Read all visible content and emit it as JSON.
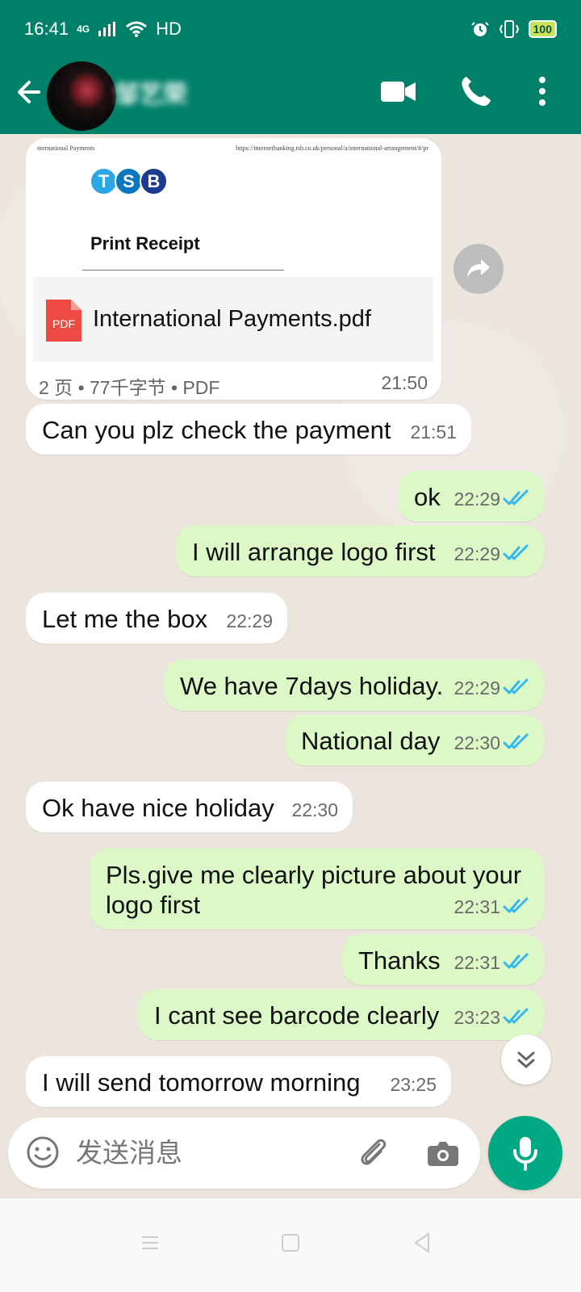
{
  "status_bar": {
    "time": "16:41",
    "network_label": "4G",
    "wifi_label": "HD",
    "battery": "100",
    "icons": [
      "signal-icon",
      "wifi-icon",
      "alarm-icon",
      "vibrate-icon",
      "battery-icon"
    ]
  },
  "header": {
    "contact_name": "邹艺荣",
    "icons": [
      "back-arrow-icon",
      "video-call-icon",
      "phone-icon",
      "more-vertical-icon"
    ]
  },
  "document_message": {
    "preview_left_text": "nternational Payments",
    "preview_url": "https://internetbanking.tsb.co.uk/personal/a/international-arrangement/#/pr",
    "logo_letters": [
      "T",
      "S",
      "B"
    ],
    "logo_colors": [
      "#2aa7e4",
      "#0c77bd",
      "#1d3b8f"
    ],
    "preview_title": "Print Receipt",
    "file_icon_label": "PDF",
    "file_name": "International Payments.pdf",
    "meta": "2 页 • 77千字节 • PDF",
    "time": "21:50"
  },
  "messages": [
    {
      "direction": "in",
      "text": "Can you plz check the payment",
      "time": "21:51"
    },
    {
      "direction": "out",
      "text": "ok",
      "time": "22:29",
      "status": "read"
    },
    {
      "direction": "out",
      "text": "I will arrange logo first",
      "time": "22:29",
      "status": "read"
    },
    {
      "direction": "in",
      "text": "Let me the box",
      "time": "22:29"
    },
    {
      "direction": "out",
      "text": "We have 7days holiday.",
      "time": "22:29",
      "status": "read"
    },
    {
      "direction": "out",
      "text": "National day",
      "time": "22:30",
      "status": "read"
    },
    {
      "direction": "in",
      "text": "Ok have nice holiday",
      "time": "22:30"
    },
    {
      "direction": "out",
      "text": "Pls.give me clearly picture about your logo first",
      "time": "22:31",
      "status": "read"
    },
    {
      "direction": "out",
      "text": "Thanks",
      "time": "22:31",
      "status": "read"
    },
    {
      "direction": "out",
      "text": "I cant see barcode clearly",
      "time": "23:23",
      "status": "read"
    },
    {
      "direction": "in",
      "text": "I will send tomorrow morning",
      "time": "23:25"
    }
  ],
  "composer": {
    "placeholder": "发送消息",
    "icons": [
      "emoji-icon",
      "attachment-icon",
      "camera-icon",
      "microphone-icon"
    ]
  },
  "colors": {
    "header_green": "#008069",
    "incoming_bubble": "#ffffff",
    "outgoing_bubble": "#dcf8c6",
    "read_ticks": "#34b7f1",
    "chat_background": "#ece5dd"
  }
}
